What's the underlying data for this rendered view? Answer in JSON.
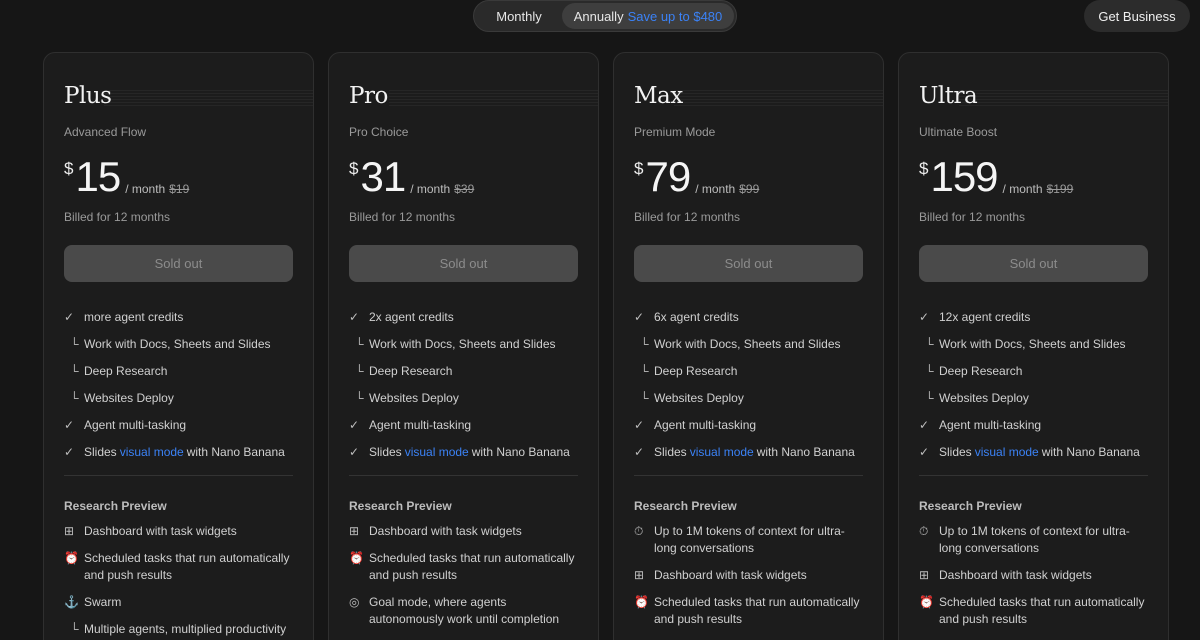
{
  "billing_toggle": {
    "monthly_label": "Monthly",
    "annual_label": "Annually",
    "save_label": "Save up to $480"
  },
  "get_business_label": "Get Business",
  "colors": {
    "accent": "#3b82f6",
    "background": "#161616",
    "card": "#1c1c1c"
  },
  "plans": [
    {
      "name": "Plus",
      "subtitle": "Advanced Flow",
      "currency": "$",
      "price": "15",
      "per": "/ month",
      "old_price": "$19",
      "billed": "Billed for 12 months",
      "button": "Sold out",
      "features": {
        "credits": "more agent credits",
        "docs": "Work with Docs, Sheets and Slides",
        "research": "Deep Research",
        "deploy": "Websites Deploy",
        "multitask": "Agent multi-tasking",
        "slides_pre": "Slides",
        "slides_link": "visual mode",
        "slides_post": "with Nano Banana"
      },
      "research_title": "Research Preview",
      "research": [
        {
          "icon": "dashboard-icon",
          "text": "Dashboard with task widgets"
        },
        {
          "icon": "alarm-icon",
          "text": "Scheduled tasks that run automatically and push results"
        },
        {
          "icon": "swarm-icon",
          "text": "Swarm"
        },
        {
          "icon": "sub-branch-icon",
          "text": "Multiple agents, multiplied productivity"
        }
      ]
    },
    {
      "name": "Pro",
      "subtitle": "Pro Choice",
      "currency": "$",
      "price": "31",
      "per": "/ month",
      "old_price": "$39",
      "billed": "Billed for 12 months",
      "button": "Sold out",
      "features": {
        "credits": "2x agent credits",
        "docs": "Work with Docs, Sheets and Slides",
        "research": "Deep Research",
        "deploy": "Websites Deploy",
        "multitask": "Agent multi-tasking",
        "slides_pre": "Slides",
        "slides_link": "visual mode",
        "slides_post": "with Nano Banana"
      },
      "research_title": "Research Preview",
      "research": [
        {
          "icon": "dashboard-icon",
          "text": "Dashboard with task widgets"
        },
        {
          "icon": "alarm-icon",
          "text": "Scheduled tasks that run automatically and push results"
        },
        {
          "icon": "goal-icon",
          "text": "Goal mode, where agents autonomously work until completion"
        }
      ]
    },
    {
      "name": "Max",
      "subtitle": "Premium Mode",
      "currency": "$",
      "price": "79",
      "per": "/ month",
      "old_price": "$99",
      "billed": "Billed for 12 months",
      "button": "Sold out",
      "features": {
        "credits": "6x agent credits",
        "docs": "Work with Docs, Sheets and Slides",
        "research": "Deep Research",
        "deploy": "Websites Deploy",
        "multitask": "Agent multi-tasking",
        "slides_pre": "Slides",
        "slides_link": "visual mode",
        "slides_post": "with Nano Banana"
      },
      "research_title": "Research Preview",
      "research": [
        {
          "icon": "context-icon",
          "text": "Up to 1M tokens of context for ultra-long conversations"
        },
        {
          "icon": "dashboard-icon",
          "text": "Dashboard with task widgets"
        },
        {
          "icon": "alarm-icon",
          "text": "Scheduled tasks that run automatically and push results"
        }
      ]
    },
    {
      "name": "Ultra",
      "subtitle": "Ultimate Boost",
      "currency": "$",
      "price": "159",
      "per": "/ month",
      "old_price": "$199",
      "billed": "Billed for 12 months",
      "button": "Sold out",
      "features": {
        "credits": "12x agent credits",
        "docs": "Work with Docs, Sheets and Slides",
        "research": "Deep Research",
        "deploy": "Websites Deploy",
        "multitask": "Agent multi-tasking",
        "slides_pre": "Slides",
        "slides_link": "visual mode",
        "slides_post": "with Nano Banana"
      },
      "research_title": "Research Preview",
      "research": [
        {
          "icon": "context-icon",
          "text": "Up to 1M tokens of context for ultra-long conversations"
        },
        {
          "icon": "dashboard-icon",
          "text": "Dashboard with task widgets"
        },
        {
          "icon": "alarm-icon",
          "text": "Scheduled tasks that run automatically and push results"
        }
      ]
    }
  ]
}
